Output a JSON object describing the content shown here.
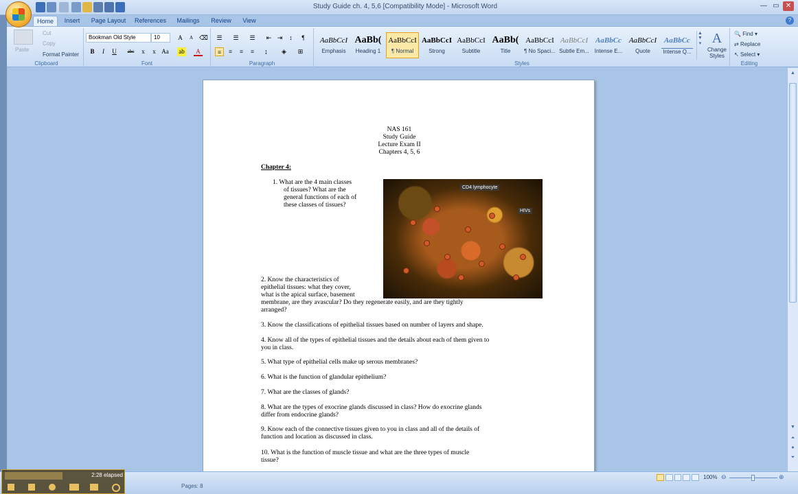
{
  "window": {
    "title": "Study Guide ch. 4, 5,6 [Compatibility Mode] - Microsoft Word"
  },
  "tabs": [
    "Home",
    "Insert",
    "Page Layout",
    "References",
    "Mailings",
    "Review",
    "View"
  ],
  "clipboard": {
    "paste": "Paste",
    "cut": "Cut",
    "copy": "Copy",
    "format_painter": "Format Painter",
    "label": "Clipboard"
  },
  "font": {
    "name": "Bookman Old Style",
    "size": "10",
    "label": "Font"
  },
  "paragraph": {
    "label": "Paragraph"
  },
  "styles": {
    "label": "Styles",
    "items": [
      {
        "sample": "AaBbCcI",
        "name": "Emphasis"
      },
      {
        "sample": "AaBb(",
        "name": "Heading 1"
      },
      {
        "sample": "AaBbCcI",
        "name": "¶ Normal"
      },
      {
        "sample": "AaBbCcI",
        "name": "Strong"
      },
      {
        "sample": "AaBbCcI",
        "name": "Subtitle"
      },
      {
        "sample": "AaBb(",
        "name": "Title"
      },
      {
        "sample": "AaBbCcI",
        "name": "¶ No Spaci..."
      },
      {
        "sample": "AaBbCcI",
        "name": "Subtle Em..."
      },
      {
        "sample": "AaBbCc",
        "name": "Intense E..."
      },
      {
        "sample": "AaBbCcI",
        "name": "Quote"
      },
      {
        "sample": "AaBbCc",
        "name": "Intense Q..."
      }
    ],
    "change": "Change Styles"
  },
  "editing": {
    "find": "Find",
    "replace": "Replace",
    "select": "Select",
    "label": "Editing"
  },
  "document": {
    "header": [
      "NAS 161",
      "Study Guide",
      "Lecture Exam II",
      "Chapters 4, 5, 6"
    ],
    "chapter": "Chapter 4:",
    "q1": [
      "1.   What are the 4 main classes",
      "of tissues?  What are the",
      "general functions of each of",
      "these classes of tissues?"
    ],
    "q2": [
      "2.  Know the characteristics of",
      "epithelial tissues:  what they cover,",
      "what is the apical surface, basement",
      "membrane, are they avascular?  Do they regenerate easily, and are they tightly",
      "arranged?"
    ],
    "q3": "3.  Know the classifications of epithelial tissues based on number of layers and shape.",
    "q4": [
      "4.  Know all of the types of epithelial tissues and the details about each of them given to",
      "you in class."
    ],
    "q5": "5.  What type of epithelial cells make up serous membranes?",
    "q6": "6.  What is the function of glandular epithelium?",
    "q7": "7.  What are the classes of glands?",
    "q8": [
      "8.  What are the types of exocrine glands discussed in class?  How do exocrine glands",
      "differ from endocrine glands?"
    ],
    "q9": [
      "9.  Know each of the connective tissues given to you in class and all of the details of",
      "function and location as discussed in class."
    ],
    "q10": [
      "10.  What is the function of muscle tissue and what are the three types of muscle",
      "tissue?"
    ],
    "figure_labels": [
      "CD4 lymphocyte",
      "HIVs"
    ]
  },
  "status": {
    "zoom": "100%",
    "pages": "Pages: 8",
    "elapsed": "2:28 elapsed"
  }
}
